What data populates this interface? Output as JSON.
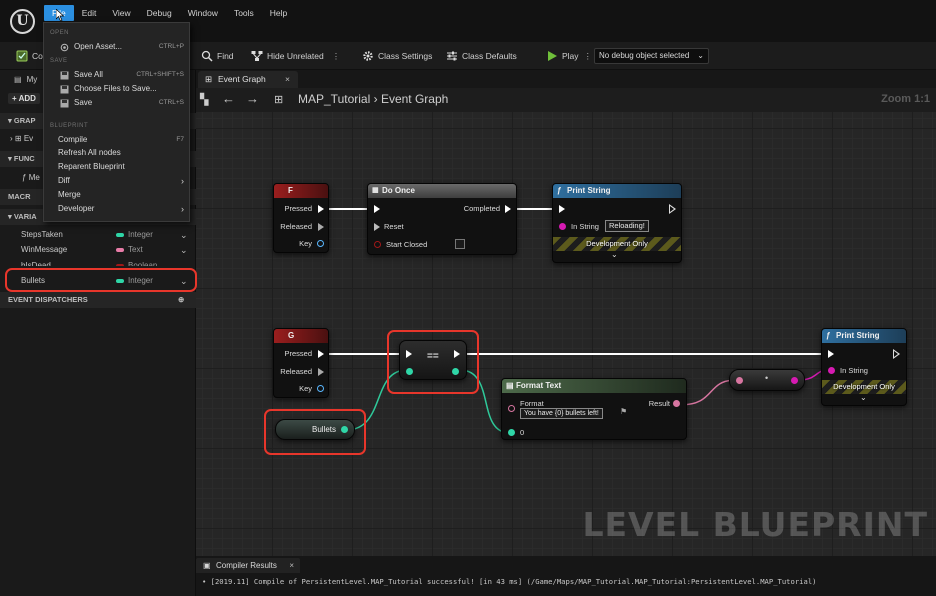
{
  "menu": [
    "File",
    "Edit",
    "View",
    "Debug",
    "Window",
    "Tools",
    "Help"
  ],
  "file_menu": {
    "sections": [
      "OPEN",
      "SAVE",
      "BLUEPRINT"
    ],
    "items": [
      {
        "label": "Open Asset...",
        "shortcut": "CTRL+P"
      },
      {
        "label": "Save All",
        "shortcut": "CTRL+SHIFT+S"
      },
      {
        "label": "Choose Files to Save...",
        "shortcut": ""
      },
      {
        "label": "Save",
        "shortcut": "CTRL+S"
      },
      {
        "label": "Compile",
        "shortcut": "F7"
      },
      {
        "label": "Refresh All nodes",
        "shortcut": ""
      },
      {
        "label": "Reparent Blueprint",
        "shortcut": ""
      },
      {
        "label": "Diff",
        "shortcut": ""
      },
      {
        "label": "Merge",
        "shortcut": ""
      },
      {
        "label": "Developer",
        "shortcut": ""
      }
    ]
  },
  "toolbar": {
    "compile_partial": "Co",
    "find": "Find",
    "hide_unrelated": "Hide Unrelated",
    "class_settings": "Class Settings",
    "class_defaults": "Class Defaults",
    "play": "Play",
    "debug_object": "No debug object selected"
  },
  "left_panel": {
    "my_partial": "My",
    "add_partial": "ADD",
    "graphs_partial": "GRAP",
    "event_partial": "Ev",
    "functions_partial": "FUNC",
    "func_item_partial": "Me",
    "macros_partial": "MACR",
    "variables_partial": "VARIA",
    "variables": [
      {
        "name": "StepsTaken",
        "type": "Integer",
        "color": "#2fd6a7"
      },
      {
        "name": "WinMessage",
        "type": "Text",
        "color": "#e87ca8"
      },
      {
        "name": "bIsDead",
        "type": "Boolean",
        "color": "#a01818"
      },
      {
        "name": "Bullets",
        "type": "Integer",
        "color": "#2fd6a7"
      }
    ],
    "event_dispatchers": "EVENT DISPATCHERS"
  },
  "tabs": {
    "graph_tab": "Event Graph",
    "compiler_tab": "Compiler Results"
  },
  "breadcrumb": {
    "map": "MAP_Tutorial",
    "sep": "›",
    "graph": "Event Graph",
    "zoom": "Zoom 1:1"
  },
  "watermark": "LEVEL BLUEPRINT",
  "nodes": {
    "key_f": {
      "title": "F",
      "pins": [
        "Pressed",
        "Released",
        "Key"
      ]
    },
    "do_once": {
      "title": "Do Once",
      "pins": [
        "Completed",
        "Reset",
        "Start Closed"
      ]
    },
    "print1": {
      "title": "Print String",
      "in_string_label": "In String",
      "in_string_value": "Reloading!",
      "footer": "Development Only"
    },
    "key_g": {
      "title": "G",
      "pins": [
        "Pressed",
        "Released",
        "Key"
      ]
    },
    "equals": {
      "title": "=="
    },
    "bullets": {
      "title": "Bullets"
    },
    "format_text": {
      "title": "Format Text",
      "format_label": "Format",
      "format_value": "You have {0} bullets left!",
      "result": "Result",
      "arg0": "0"
    },
    "print2": {
      "title": "Print String",
      "in_string_label": "In String",
      "footer": "Development Only"
    }
  },
  "log_line": "• [2019.11] Compile of PersistentLevel.MAP_Tutorial successful! [in 43 ms] (/Game/Maps/MAP_Tutorial.MAP_Tutorial:PersistentLevel.MAP_Tutorial)"
}
